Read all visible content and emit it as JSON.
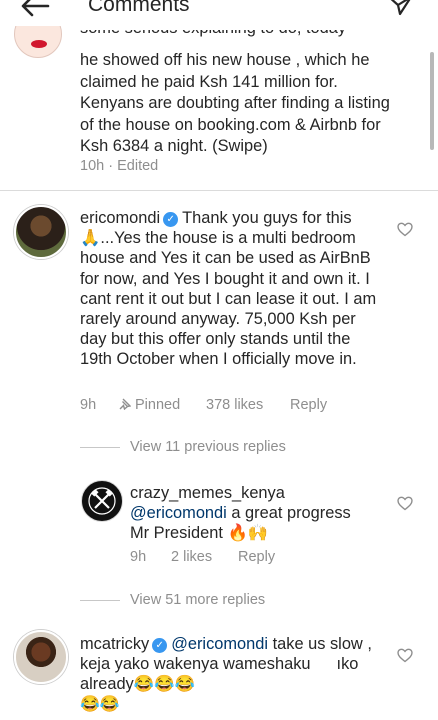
{
  "header": {
    "title": "Comments"
  },
  "caption": {
    "cut_line": "some serious explaining to do, today",
    "text": "he  showed off his new house , which he claimed he paid Ksh 141  million for. Kenyans are doubting after finding a listing of the house on booking.com & Airbnb for Ksh 6384 a night. (Swipe)",
    "time": "10h",
    "separator": "·",
    "edited": "Edited"
  },
  "comments": [
    {
      "username": "ericomondi",
      "verified": true,
      "text": "Thank you guys for this 🙏...Yes the house is a multi bedroom house and Yes it can be used as AirBnB for now, and Yes I bought it and own it. I cant rent it out but I can lease it out. I am rarely around anyway. 75,000 Ksh per day but this offer only stands until the 19th October when I officially move in.",
      "time": "9h",
      "pinned_label": "Pinned",
      "likes": "378 likes",
      "reply_label": "Reply",
      "view_previous": "View 11 previous replies",
      "reply": {
        "username": "crazy_memes_kenya",
        "mention": "@ericomondi",
        "text": " a great progress Mr President 🔥🙌",
        "time": "9h",
        "likes": "2 likes",
        "reply_label": "Reply"
      },
      "view_more": "View 51 more replies"
    },
    {
      "username": "mcatricky",
      "verified": true,
      "mention": "@ericomondi",
      "text": " take us slow , keja yako wakenya wameshaku",
      "text_after_gap": "ıko  already😂😂😂",
      "text_last": "😂😂"
    }
  ],
  "icons": {
    "back": "back-arrow-icon",
    "send": "send-icon",
    "heart": "heart-outline-icon",
    "verified": "verified-badge-icon",
    "pin": "pin-icon"
  },
  "colors": {
    "text": "#262626",
    "muted": "#8e8e8e",
    "verified": "#3897f0",
    "mention": "#00376b"
  }
}
